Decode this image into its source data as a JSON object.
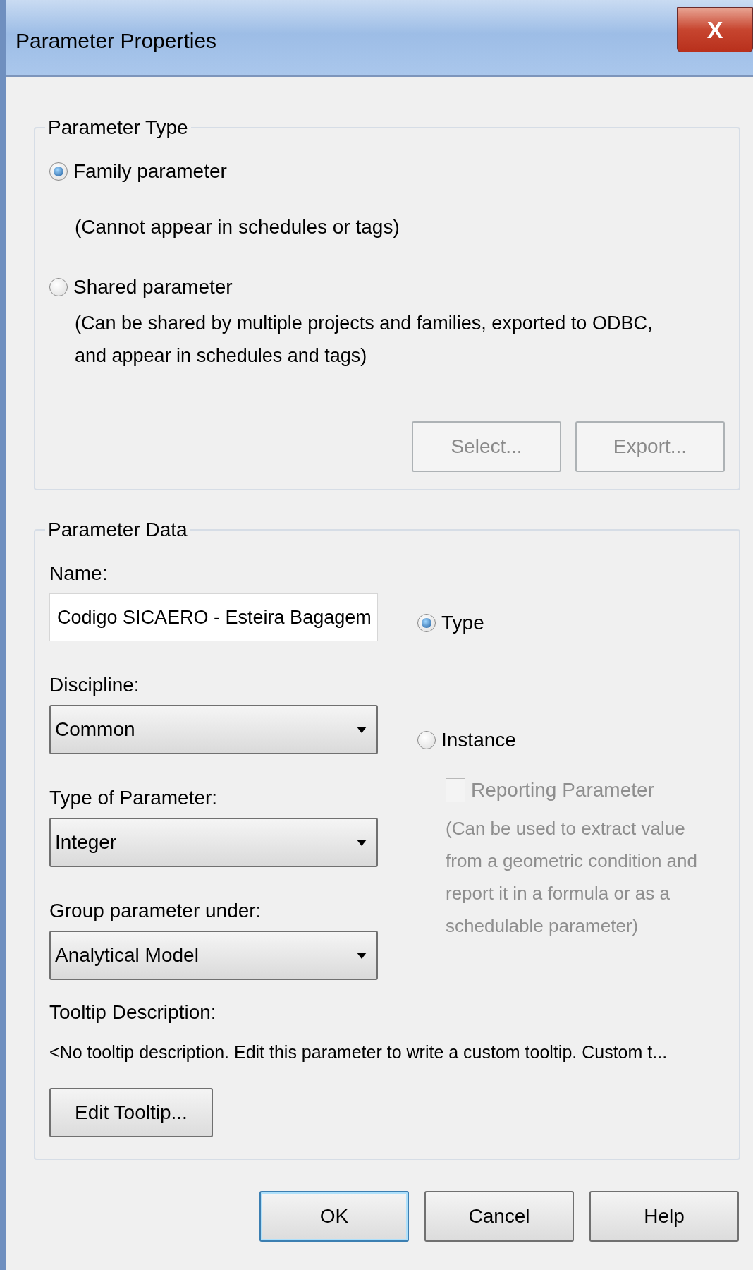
{
  "window": {
    "title": "Parameter Properties",
    "close_button": "X"
  },
  "parameter_type": {
    "title": "Parameter Type",
    "options": [
      {
        "label": "Family parameter",
        "note": "(Cannot appear in schedules or tags)",
        "selected": true
      },
      {
        "label": "Shared parameter",
        "note": "(Can be shared by multiple projects and families, exported to ODBC, and appear in schedules and tags)",
        "selected": false
      }
    ],
    "buttons": [
      {
        "label": "Select...",
        "disabled": true
      },
      {
        "label": "Export...",
        "disabled": true
      }
    ]
  },
  "parameter_data": {
    "title": "Parameter Data",
    "name_label": "Name:",
    "name_value": "Codigo SICAERO - Esteira Bagagem",
    "dropdowns": [
      {
        "label": "Discipline:",
        "value": "Common"
      },
      {
        "label": "Type of Parameter:",
        "value": "Integer"
      },
      {
        "label": "Group parameter under:",
        "value": "Analytical Model"
      }
    ],
    "scope": [
      {
        "label": "Type",
        "selected": true
      },
      {
        "label": "Instance",
        "selected": false
      }
    ],
    "reporting": {
      "label": "Reporting Parameter",
      "checked": false,
      "disabled": true,
      "note": "(Can be used to extract value from a geometric condition and report it in a formula or as a schedulable parameter)"
    },
    "tooltip_label": "Tooltip Description:",
    "tooltip_text": "<No tooltip description. Edit this parameter to write a custom tooltip. Custom t...",
    "edit_button": "Edit Tooltip..."
  },
  "buttons": [
    {
      "label": "OK",
      "default": true
    },
    {
      "label": "Cancel",
      "default": false
    },
    {
      "label": "Help",
      "default": false
    }
  ]
}
